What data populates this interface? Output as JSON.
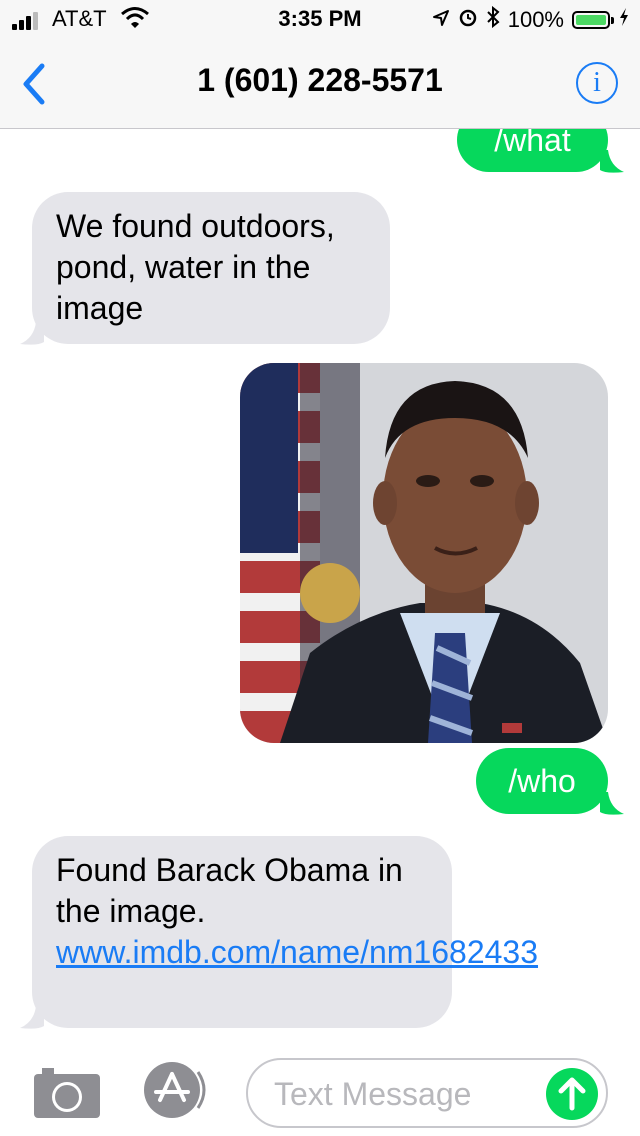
{
  "status_bar": {
    "carrier": "AT&T",
    "time": "3:35 PM",
    "battery": "100%",
    "battery_level": 1.0
  },
  "nav": {
    "title": "1 (601) 228-5571"
  },
  "messages": {
    "m1": {
      "text": "/what"
    },
    "m2": {
      "text": "We found outdoors, pond, water in the image"
    },
    "m4": {
      "text": "/who"
    },
    "m5": {
      "text": "Found Barack Obama in the image.",
      "link": "www.imdb.com/name/nm1682433"
    }
  },
  "input": {
    "placeholder": "Text Message"
  },
  "colors": {
    "outgoing": "#06d85c",
    "incoming": "#e5e5ea",
    "accent": "#1a7cf5"
  }
}
